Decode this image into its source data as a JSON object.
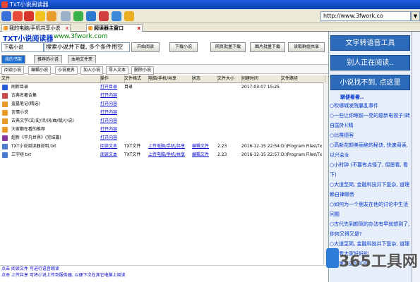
{
  "window": {
    "title": "TxT小说阅读器"
  },
  "toolbar": {
    "url": "http://www.3fwork.co"
  },
  "browser_tabs": [
    {
      "label": "我的电脑/手机共享小说"
    },
    {
      "label": "阅读器主窗口"
    }
  ],
  "app": {
    "logo_text": "TXT小说阅读器",
    "logo_url": "www.3fwork.com"
  },
  "search": {
    "select_value": "下载小说",
    "input_value": "搜索小说并下载, 多个条件用空"
  },
  "action_buttons": [
    "开始阅读",
    "下载小说",
    "网页批量下载",
    "图片批量下载",
    "读取群组共享"
  ],
  "nav_tabs": [
    "我的书架",
    "推荐的小说",
    "本地文件夹"
  ],
  "sub_toolbar": [
    "阅读小说",
    "编辑小说",
    "小说更名",
    "加入小说",
    "导入文本",
    "删除小说"
  ],
  "table": {
    "headers": [
      "文件",
      "操作",
      "文件格式",
      "电脑/手机/共享",
      "状态",
      "文件大小",
      "创建时间",
      "文件路径"
    ],
    "rows": [
      {
        "name": "刷新目录",
        "action": "打开目录",
        "format": "目录",
        "share": "",
        "status": "",
        "size": "",
        "time": "2017-03-07 15:25",
        "path": "",
        "icon": "#2a5bd7"
      },
      {
        "name": "古典名著合集",
        "action": "打开内容",
        "format": "",
        "share": "",
        "status": "",
        "size": "",
        "time": "",
        "path": "",
        "icon": "#c84848"
      },
      {
        "name": "盗墓笔记(精选)",
        "action": "打开内容",
        "format": "",
        "share": "",
        "status": "",
        "size": "",
        "time": "",
        "path": "",
        "icon": "#e89a28"
      },
      {
        "name": "言情小说",
        "action": "打开内容",
        "format": "",
        "share": "",
        "status": "",
        "size": "",
        "time": "",
        "path": "",
        "icon": "#e89a28"
      },
      {
        "name": "古典文学(文/史/诗/词/曲/赋/小说)",
        "action": "打开内容",
        "format": "",
        "share": "",
        "status": "",
        "size": "",
        "time": "",
        "path": "",
        "icon": "#e89a28"
      },
      {
        "name": "大家都在看的推荐",
        "action": "打开内容",
        "format": "",
        "share": "",
        "status": "",
        "size": "",
        "time": "",
        "path": "",
        "icon": "#e89a28"
      },
      {
        "name": "超新《平凡世界》(完结篇)",
        "action": "打开内容",
        "format": "",
        "share": "",
        "status": "",
        "size": "",
        "time": "",
        "path": "",
        "icon": "#8a3a9a"
      },
      {
        "name": "TXT小说阅读器说明.txt",
        "action": "阅读文本",
        "format": "TXT文件",
        "share": "上传电脑/手机/共享",
        "status": "编辑文件",
        "size": "2.23",
        "time": "2016-12-15 22:54:3",
        "path": "D:\\Program Files\\Tx",
        "icon": "#4a7ad0"
      },
      {
        "name": "三字经.txt",
        "action": "阅读文本",
        "format": "TXT文件",
        "share": "上传电脑/手机/共享",
        "status": "编辑文件",
        "size": "2.23",
        "time": "2016-12-15 22:57:0",
        "path": "D:\\Program Files\\Tx",
        "icon": "#4a7ad0"
      }
    ]
  },
  "status_bar": {
    "line1": "点击 阅读文件 可进行语音朗读",
    "line2": "点击 上传共享 可将小说上传到服务器, 以便下次在其它电脑上阅读"
  },
  "right_panel": {
    "buttons": [
      "文字转语音工具",
      "别人正在阅读..",
      "小说找不到, 点这里"
    ],
    "heading": "聊便看看..",
    "items": [
      "○吹哪城发院暴乱事件",
      "○一些让你眼前一亮的题新电视子(转自国外)(精",
      "○比赛德客",
      "○高新花颜美丽绝的秘诀, 快速阅读, 以兴会女",
      "○小时钟 (不要有点怪了, 但愿看, 看下)",
      "○大道至简, 金融科技并下复杂, 道理赖自律赐帝",
      "○如何为一个朋友在他的讨论中生活问题",
      "○古代先到颜驾的办法有早就想到了, 你何又得又是?",
      "○大道至简, 金融科技并下复杂, 道理",
      "○请看大家好好的",
      "○心里想更好的事"
    ]
  },
  "watermark": "365工具网",
  "colors": {
    "accent": "#2c6bb9",
    "link": "#0000cc",
    "title_bar": "#0a3fb0"
  }
}
